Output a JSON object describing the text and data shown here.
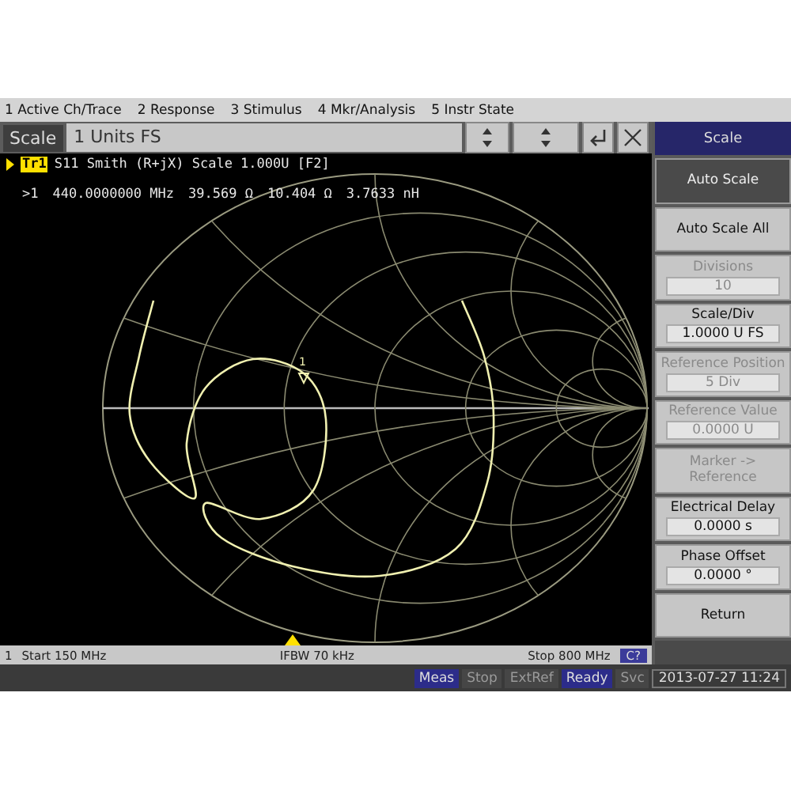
{
  "menu": [
    "1 Active Ch/Trace",
    "2 Response",
    "3 Stimulus",
    "4 Mkr/Analysis",
    "5 Instr State"
  ],
  "entry": {
    "label": "Scale",
    "value": "1 Units FS"
  },
  "trace": {
    "label": "Tr1",
    "title": "S11 Smith (R+jX) Scale 1.000U [F2]"
  },
  "marker_readout": {
    "marker": ">1",
    "stimulus": "440.0000000 MHz",
    "resistance": "39.569 Ω",
    "reactance": "10.404 Ω",
    "inductance": "3.7633 nH"
  },
  "chart_marker": {
    "label": "1"
  },
  "footer": {
    "channel": "1",
    "start": "Start 150 MHz",
    "ifbw": "IFBW 70 kHz",
    "stop": "Stop 800 MHz",
    "badge": "C?"
  },
  "softkeys": [
    {
      "kind": "header",
      "label": "Scale"
    },
    {
      "kind": "button",
      "label": "Auto Scale",
      "selected": true,
      "disabled": false
    },
    {
      "kind": "button",
      "label": "Auto Scale All",
      "selected": false,
      "disabled": false
    },
    {
      "kind": "field",
      "label": "Divisions",
      "value": "10",
      "disabled": true
    },
    {
      "kind": "field",
      "label": "Scale/Div",
      "value": "1.0000 U FS",
      "disabled": false
    },
    {
      "kind": "field",
      "label": "Reference Position",
      "value": "5 Div",
      "disabled": true
    },
    {
      "kind": "field",
      "label": "Reference Value",
      "value": "0.0000 U",
      "disabled": true
    },
    {
      "kind": "button",
      "label": "Marker ->\nReference",
      "selected": false,
      "disabled": true
    },
    {
      "kind": "field",
      "label": "Electrical Delay",
      "value": "0.0000 s",
      "disabled": false
    },
    {
      "kind": "field",
      "label": "Phase Offset",
      "value": "0.0000 °",
      "disabled": false
    },
    {
      "kind": "button",
      "label": "Return",
      "selected": false,
      "disabled": false
    }
  ],
  "status": [
    {
      "label": "Meas",
      "on": true
    },
    {
      "label": "Stop",
      "on": false
    },
    {
      "label": "ExtRef",
      "on": false
    },
    {
      "label": "Ready",
      "on": true
    },
    {
      "label": "Svc",
      "on": false
    }
  ],
  "datetime": "2013-07-27 11:24"
}
